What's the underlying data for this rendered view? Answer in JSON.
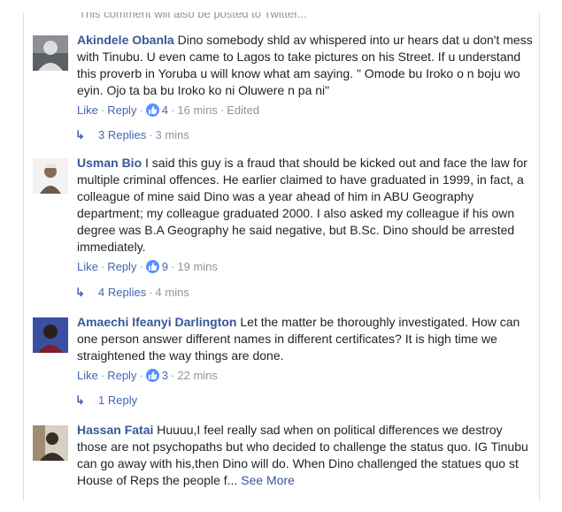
{
  "cutoff_text": "This comment will also be posted to Twitter...",
  "comments": [
    {
      "author": "Akindele Obanla",
      "text": "Dino somebody shld av whispered into ur hears dat u don't mess with Tinubu. U even came to Lagos to take pictures on his Street. If u understand this proverb in Yoruba u will know what am saying. \" Omode bu Iroko o n boju wo eyin. Ojo ta ba bu Iroko ko ni Oluwere n pa ni\"",
      "like_label": "Like",
      "reply_label": "Reply",
      "likes": "4",
      "time": "16 mins",
      "edited": "Edited",
      "replies_label": "3 Replies",
      "replies_time": "3 mins",
      "avatar_colors": [
        "#8d8f95",
        "#dcdde0",
        "#5c5f66"
      ]
    },
    {
      "author": "Usman Bio",
      "text": "I said this guy is a fraud that should be kicked out and face the law for multiple criminal offences. He earlier claimed to have graduated in 1999, in fact, a colleague of mine said Dino was a year ahead of him in ABU Geography department; my colleague graduated 2000. I also asked my colleague if his own degree was B.A Geography he said negative, but B.Sc. Dino should be arrested immediately.",
      "like_label": "Like",
      "reply_label": "Reply",
      "likes": "9",
      "time": "19 mins",
      "replies_label": "4 Replies",
      "replies_time": "4 mins",
      "avatar_colors": [
        "#f2f2f2",
        "#8a6b55",
        "#e8e8e8"
      ]
    },
    {
      "author": "Amaechi Ifeanyi Darlington",
      "text": "Let the matter be thoroughly investigated. How can one person answer different names in different certificates? It is high time we straightened the way things are done.",
      "like_label": "Like",
      "reply_label": "Reply",
      "likes": "3",
      "time": "22 mins",
      "replies_label": "1 Reply",
      "avatar_colors": [
        "#3b4fa0",
        "#2a2018",
        "#7a1f2b"
      ]
    },
    {
      "author": "Hassan Fatai",
      "text": "Huuuu,I feel really sad when on political differences we destroy those are not psychopaths but who decided to challenge the status quo. IG Tinubu can go away with his,then Dino will do. When Dino challenged the statues quo st House of Reps the people f...",
      "see_more": "See More",
      "avatar_colors": [
        "#a08c70",
        "#3a2e24",
        "#d7d0c4"
      ]
    }
  ]
}
